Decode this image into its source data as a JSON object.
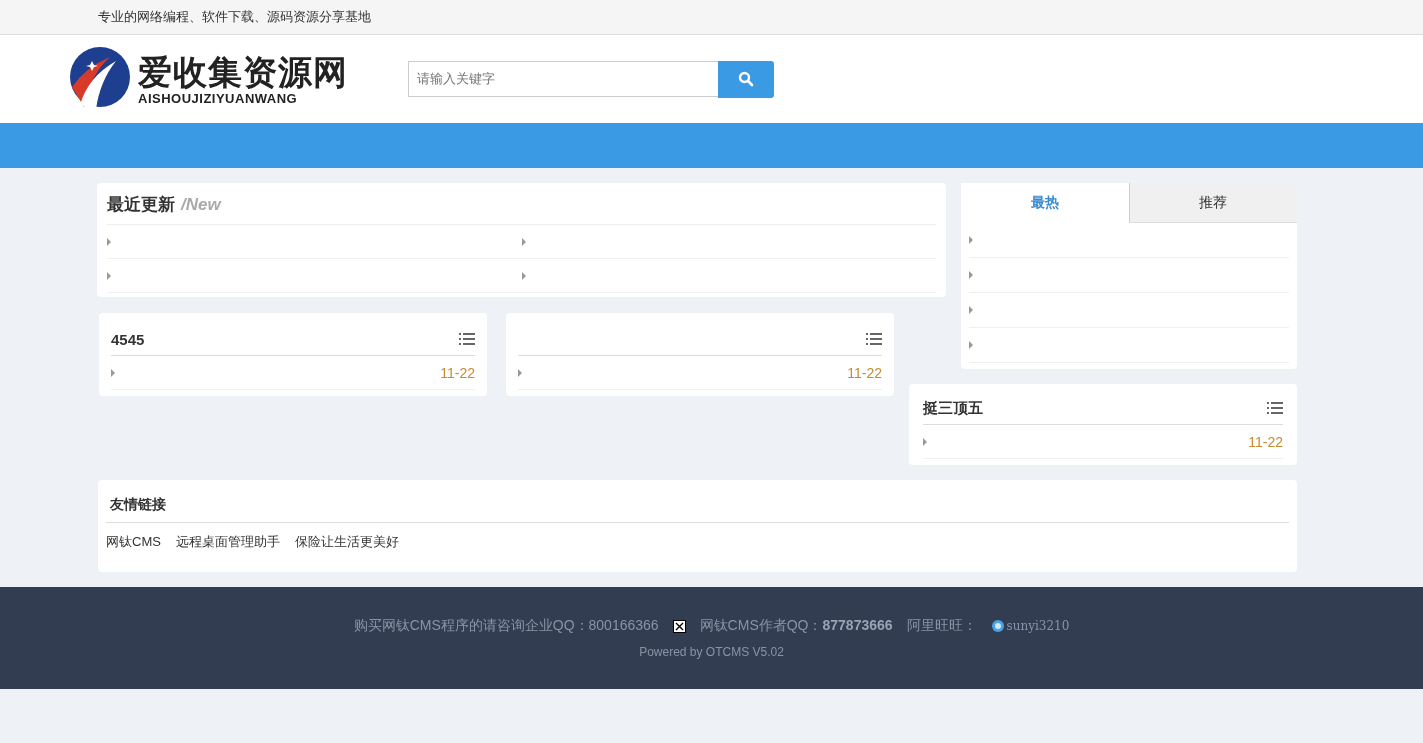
{
  "top_bar": {
    "slogan": "专业的网络编程、软件下载、源码资源分享基地"
  },
  "header": {
    "logo_title": "爱收集资源网",
    "logo_subtitle": "AISHOUJIZIYUANWANG",
    "search": {
      "placeholder": "请输入关键字"
    }
  },
  "recent": {
    "title": "最近更新",
    "subtitle": "/New",
    "items": [
      {
        "kind": "bullet"
      },
      {
        "kind": "bullet"
      },
      {
        "kind": "bullet"
      },
      {
        "kind": "bullet"
      }
    ]
  },
  "boxes": [
    {
      "title": "4545",
      "items": [
        {
          "kind": "bullet",
          "date": "11-22"
        }
      ]
    },
    {
      "items": [
        {
          "kind": "bullet",
          "date": "11-22"
        }
      ]
    }
  ],
  "tabs": [
    {
      "label": "最热",
      "selected": true
    },
    {
      "label": "推荐",
      "selected": false
    }
  ],
  "tab_items": [
    {
      "kind": "bullet"
    },
    {
      "kind": "bullet"
    },
    {
      "kind": "bullet"
    },
    {
      "kind": "bullet"
    }
  ],
  "side_box": {
    "title": "挺三顶五",
    "items": [
      {
        "kind": "bullet",
        "date": "11-22"
      }
    ]
  },
  "links": {
    "title": "友情链接",
    "items": [
      "网钛CMS",
      "远程桌面管理助手",
      "保险让生活更美好"
    ]
  },
  "footer": {
    "contact": "购买网钛CMS程序的请咨询企业QQ：800166366",
    "author_label": "网钛CMS作者QQ：",
    "author_qq": "877873666",
    "wangwang_label": "阿里旺旺：",
    "wangwang": "sunyi3210",
    "powered": "Powered by OTCMS V5.02"
  }
}
